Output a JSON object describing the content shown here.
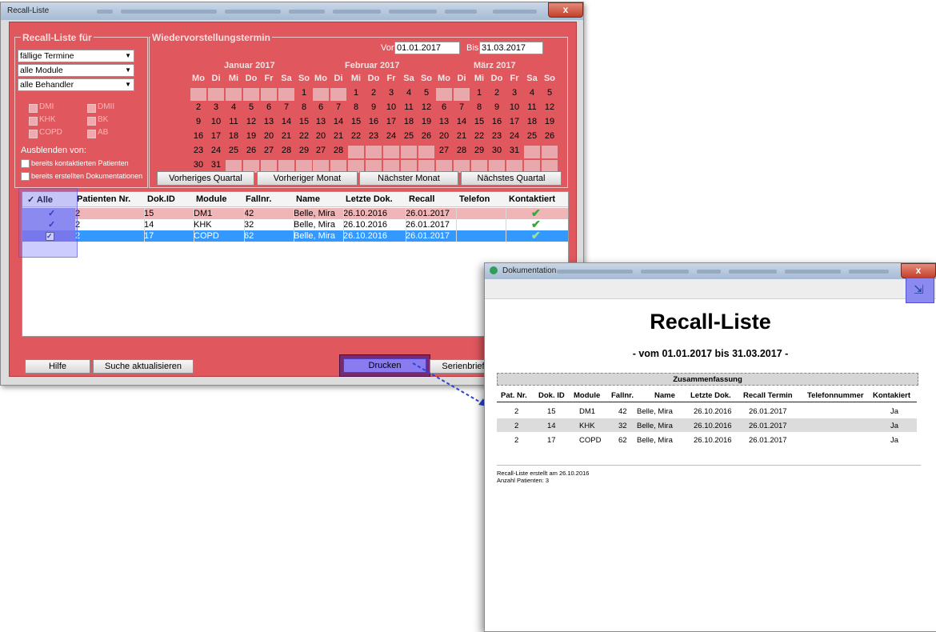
{
  "main": {
    "title": "Recall-Liste",
    "close_label": "x",
    "recall_group": {
      "label": "Recall-Liste für",
      "combo1": "fällige Termine",
      "combo2": "alle Module",
      "combo3": "alle Behandler",
      "modules": [
        "DMI",
        "DMII",
        "KHK",
        "BK",
        "COPD",
        "AB"
      ],
      "hide_label": "Ausblenden von:",
      "hide_options": [
        "bereits kontaktierten Patienten",
        "bereits erstellten Dokumentationen"
      ]
    },
    "wv_group": {
      "label": "Wiedervorstellungstermin",
      "von_label": "Von",
      "von_value": "01.01.2017",
      "bis_label": "Bis",
      "bis_value": "31.03.2017",
      "day_headers": [
        "Mo",
        "Di",
        "Mi",
        "Do",
        "Fr",
        "Sa",
        "So"
      ],
      "months": [
        {
          "name": "Januar 2017",
          "rows": [
            [
              "",
              "",
              "",
              "",
              "",
              "",
              "1"
            ],
            [
              "2",
              "3",
              "4",
              "5",
              "6",
              "7",
              "8"
            ],
            [
              "9",
              "10",
              "11",
              "12",
              "13",
              "14",
              "15"
            ],
            [
              "16",
              "17",
              "18",
              "19",
              "20",
              "21",
              "22"
            ],
            [
              "23",
              "24",
              "25",
              "26",
              "27",
              "28",
              "29"
            ],
            [
              "30",
              "31",
              "",
              "",
              "",
              "",
              ""
            ]
          ]
        },
        {
          "name": "Februar 2017",
          "rows": [
            [
              "",
              "",
              "1",
              "2",
              "3",
              "4",
              "5"
            ],
            [
              "6",
              "7",
              "8",
              "9",
              "10",
              "11",
              "12"
            ],
            [
              "13",
              "14",
              "15",
              "16",
              "17",
              "18",
              "19"
            ],
            [
              "20",
              "21",
              "22",
              "23",
              "24",
              "25",
              "26"
            ],
            [
              "27",
              "28",
              "",
              "",
              "",
              "",
              ""
            ],
            [
              "",
              "",
              "",
              "",
              "",
              "",
              ""
            ]
          ]
        },
        {
          "name": "März 2017",
          "rows": [
            [
              "",
              "",
              "1",
              "2",
              "3",
              "4",
              "5"
            ],
            [
              "6",
              "7",
              "8",
              "9",
              "10",
              "11",
              "12"
            ],
            [
              "13",
              "14",
              "15",
              "16",
              "17",
              "18",
              "19"
            ],
            [
              "20",
              "21",
              "22",
              "23",
              "24",
              "25",
              "26"
            ],
            [
              "27",
              "28",
              "29",
              "30",
              "31",
              "",
              ""
            ],
            [
              "",
              "",
              "",
              "",
              "",
              "",
              ""
            ]
          ]
        }
      ],
      "buttons": [
        "Vorheriges Quartal",
        "Vorheriger Monat",
        "Nächster Monat",
        "Nächstes Quartal"
      ]
    },
    "table": {
      "select_all": "Alle",
      "headers": [
        "Patienten Nr.",
        "Dok.ID",
        "Module",
        "Fallnr.",
        "Name",
        "Letzte Dok.",
        "Recall",
        "Telefon",
        "Kontaktiert"
      ],
      "rows": [
        [
          "2",
          "15",
          "DM1",
          "42",
          "Belle, Mira",
          "26.10.2016",
          "26.01.2017",
          ""
        ],
        [
          "2",
          "14",
          "KHK",
          "32",
          "Belle, Mira",
          "26.10.2016",
          "26.01.2017",
          ""
        ],
        [
          "2",
          "17",
          "COPD",
          "62",
          "Belle, Mira",
          "26.10.2016",
          "26.01.2017",
          ""
        ]
      ]
    },
    "buttons": {
      "hilfe": "Hilfe",
      "suche": "Suche aktualisieren",
      "drucken": "Drucken",
      "serienbrief": "Serienbrief"
    }
  },
  "doc": {
    "window_title": "Dokumentation",
    "title": "Recall-Liste",
    "subtitle": "- vom 01.01.2017 bis 31.03.2017 -",
    "summary_label": "Zusammenfassung",
    "headers": [
      "Pat. Nr.",
      "Dok. ID",
      "Module",
      "Fallnr.",
      "Name",
      "Letzte Dok.",
      "Recall Termin",
      "Telefonnummer",
      "Kontakiert"
    ],
    "rows": [
      [
        "2",
        "15",
        "DM1",
        "42",
        "Belle, Mira",
        "26.10.2016",
        "26.01.2017",
        "",
        "Ja"
      ],
      [
        "2",
        "14",
        "KHK",
        "32",
        "Belle, Mira",
        "26.10.2016",
        "26.01.2017",
        "",
        "Ja"
      ],
      [
        "2",
        "17",
        "COPD",
        "62",
        "Belle, Mira",
        "26.10.2016",
        "26.01.2017",
        "",
        "Ja"
      ]
    ],
    "footer1": "Recall-Liste erstellt am 26.10.2016",
    "footer2": "Anzahl Patienten: 3"
  },
  "colors": {
    "panel": "#e0585e",
    "highlight": "#3399ff",
    "annotation": "#8a6cff"
  }
}
